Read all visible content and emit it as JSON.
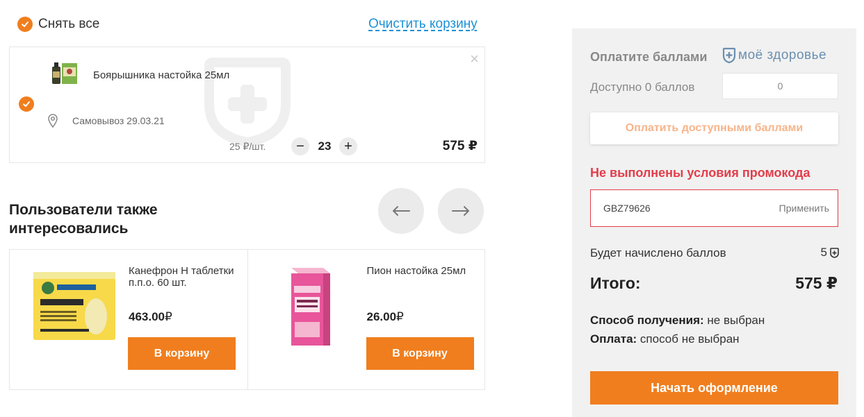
{
  "cart_header": {
    "deselect_all_label": "Снять все",
    "clear_cart_label": "Очистить корзину"
  },
  "cart_item": {
    "name": "Боярышника настойка 25мл",
    "pickup": "Самовывоз 29.03.21",
    "unit_price": "25 ₽/шт.",
    "quantity": "23",
    "total": "575 ₽",
    "minus_label": "−",
    "plus_label": "+",
    "close_label": "×"
  },
  "recommendations": {
    "title": "Пользователи также интересовались",
    "items": [
      {
        "name": "Канефрон Н таблетки п.п.о. 60 шт.",
        "price": "463.00",
        "currency": "₽",
        "button": "В корзину"
      },
      {
        "name": "Пион настойка 25мл",
        "price": "26.00",
        "currency": "₽",
        "button": "В корзину"
      }
    ]
  },
  "sidebar": {
    "pay_with_points": "Оплатите баллами",
    "brand_name": "моё здоровье",
    "available_points": "Доступно 0 баллов",
    "points_input_value": "0",
    "pay_available_button": "Оплатить доступными баллами",
    "promo_error": "Не выполнены условия промокода",
    "promo_code": "GBZ79626",
    "promo_apply": "Применить",
    "bonus_label": "Будет начислено баллов",
    "bonus_value": "5",
    "total_label": "Итого:",
    "total_value": "575 ₽",
    "delivery_label": "Способ получения:",
    "delivery_value": "не выбран",
    "payment_label": "Оплата:",
    "payment_value": "способ не выбран",
    "checkout_button": "Начать оформление"
  },
  "colors": {
    "accent": "#f07e1e",
    "link": "#1d91d6",
    "error": "#e33d4a",
    "sidebar_bg": "#f1f1f1"
  }
}
